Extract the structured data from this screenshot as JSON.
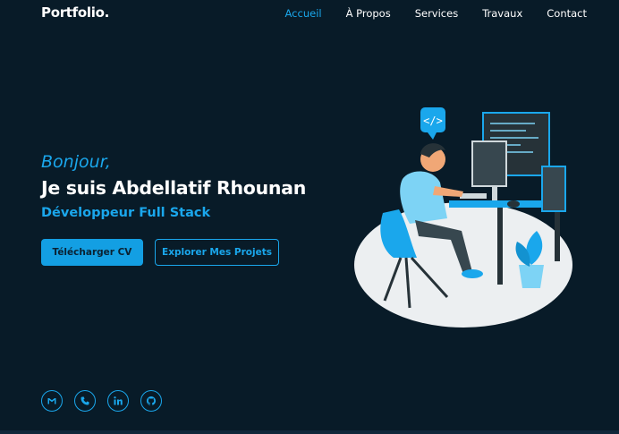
{
  "nav": {
    "logo": "Portfolio.",
    "links": [
      {
        "label": "Accueil",
        "active": true
      },
      {
        "label": "À Propos",
        "active": false
      },
      {
        "label": "Services",
        "active": false
      },
      {
        "label": "Travaux",
        "active": false
      },
      {
        "label": "Contact",
        "active": false
      }
    ]
  },
  "hero": {
    "greeting": "Bonjour,",
    "name": "Je suis Abdellatif Rhounan",
    "role": "Développeur Full Stack",
    "primary_button": "Télécharger CV",
    "secondary_button": "Explorer Mes Projets"
  },
  "socials": [
    "gmail-icon",
    "phone-icon",
    "linkedin-icon",
    "github-icon"
  ],
  "colors": {
    "background": "#081b28",
    "accent": "#1aa7ec",
    "text": "#ffffff"
  }
}
